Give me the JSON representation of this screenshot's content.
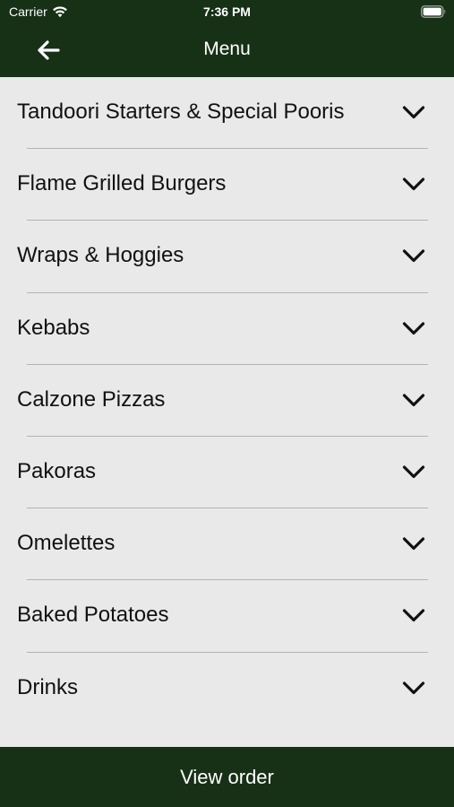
{
  "status_bar": {
    "carrier": "Carrier",
    "time": "7:36 PM",
    "wifi_icon": "wifi-icon",
    "battery_icon": "battery-icon"
  },
  "nav": {
    "title": "Menu",
    "back_icon": "arrow-left-icon"
  },
  "menu": {
    "items": [
      {
        "label": "Tandoori Starters & Special Pooris"
      },
      {
        "label": "Flame Grilled Burgers"
      },
      {
        "label": "Wraps & Hoggies"
      },
      {
        "label": "Kebabs"
      },
      {
        "label": "Calzone Pizzas"
      },
      {
        "label": "Pakoras"
      },
      {
        "label": "Omelettes"
      },
      {
        "label": "Baked Potatoes"
      },
      {
        "label": "Drinks"
      }
    ],
    "item_icon": "chevron-down-icon"
  },
  "footer": {
    "view_order_label": "View order"
  },
  "colors": {
    "header_bg": "#173117",
    "footer_bg": "#173117",
    "list_bg": "#e9e9e9",
    "divider": "#b3b3b3",
    "header_text": "#ffffff",
    "item_text": "#111111"
  }
}
